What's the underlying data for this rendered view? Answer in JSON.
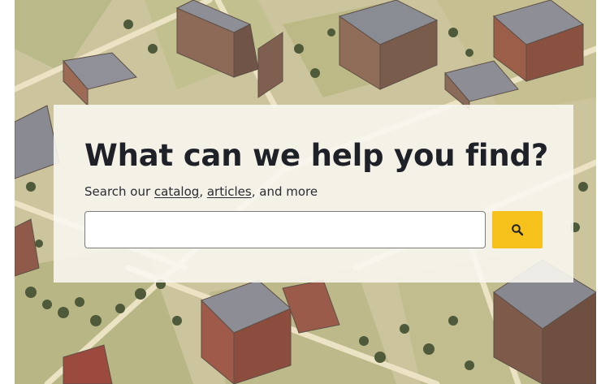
{
  "search": {
    "heading": "What can we help you find?",
    "intro_prefix": "Search our ",
    "catalog_link": "catalog",
    "separator": ", ",
    "articles_link": "articles",
    "intro_suffix": ", and more",
    "input_value": "",
    "input_placeholder": "",
    "button_icon": "search-icon"
  },
  "colors": {
    "button_background": "#f7c11b",
    "heading_text": "#1f2129",
    "panel_background": "#f8f6f0"
  },
  "background": {
    "description_icon": "campus-map-illustration"
  }
}
